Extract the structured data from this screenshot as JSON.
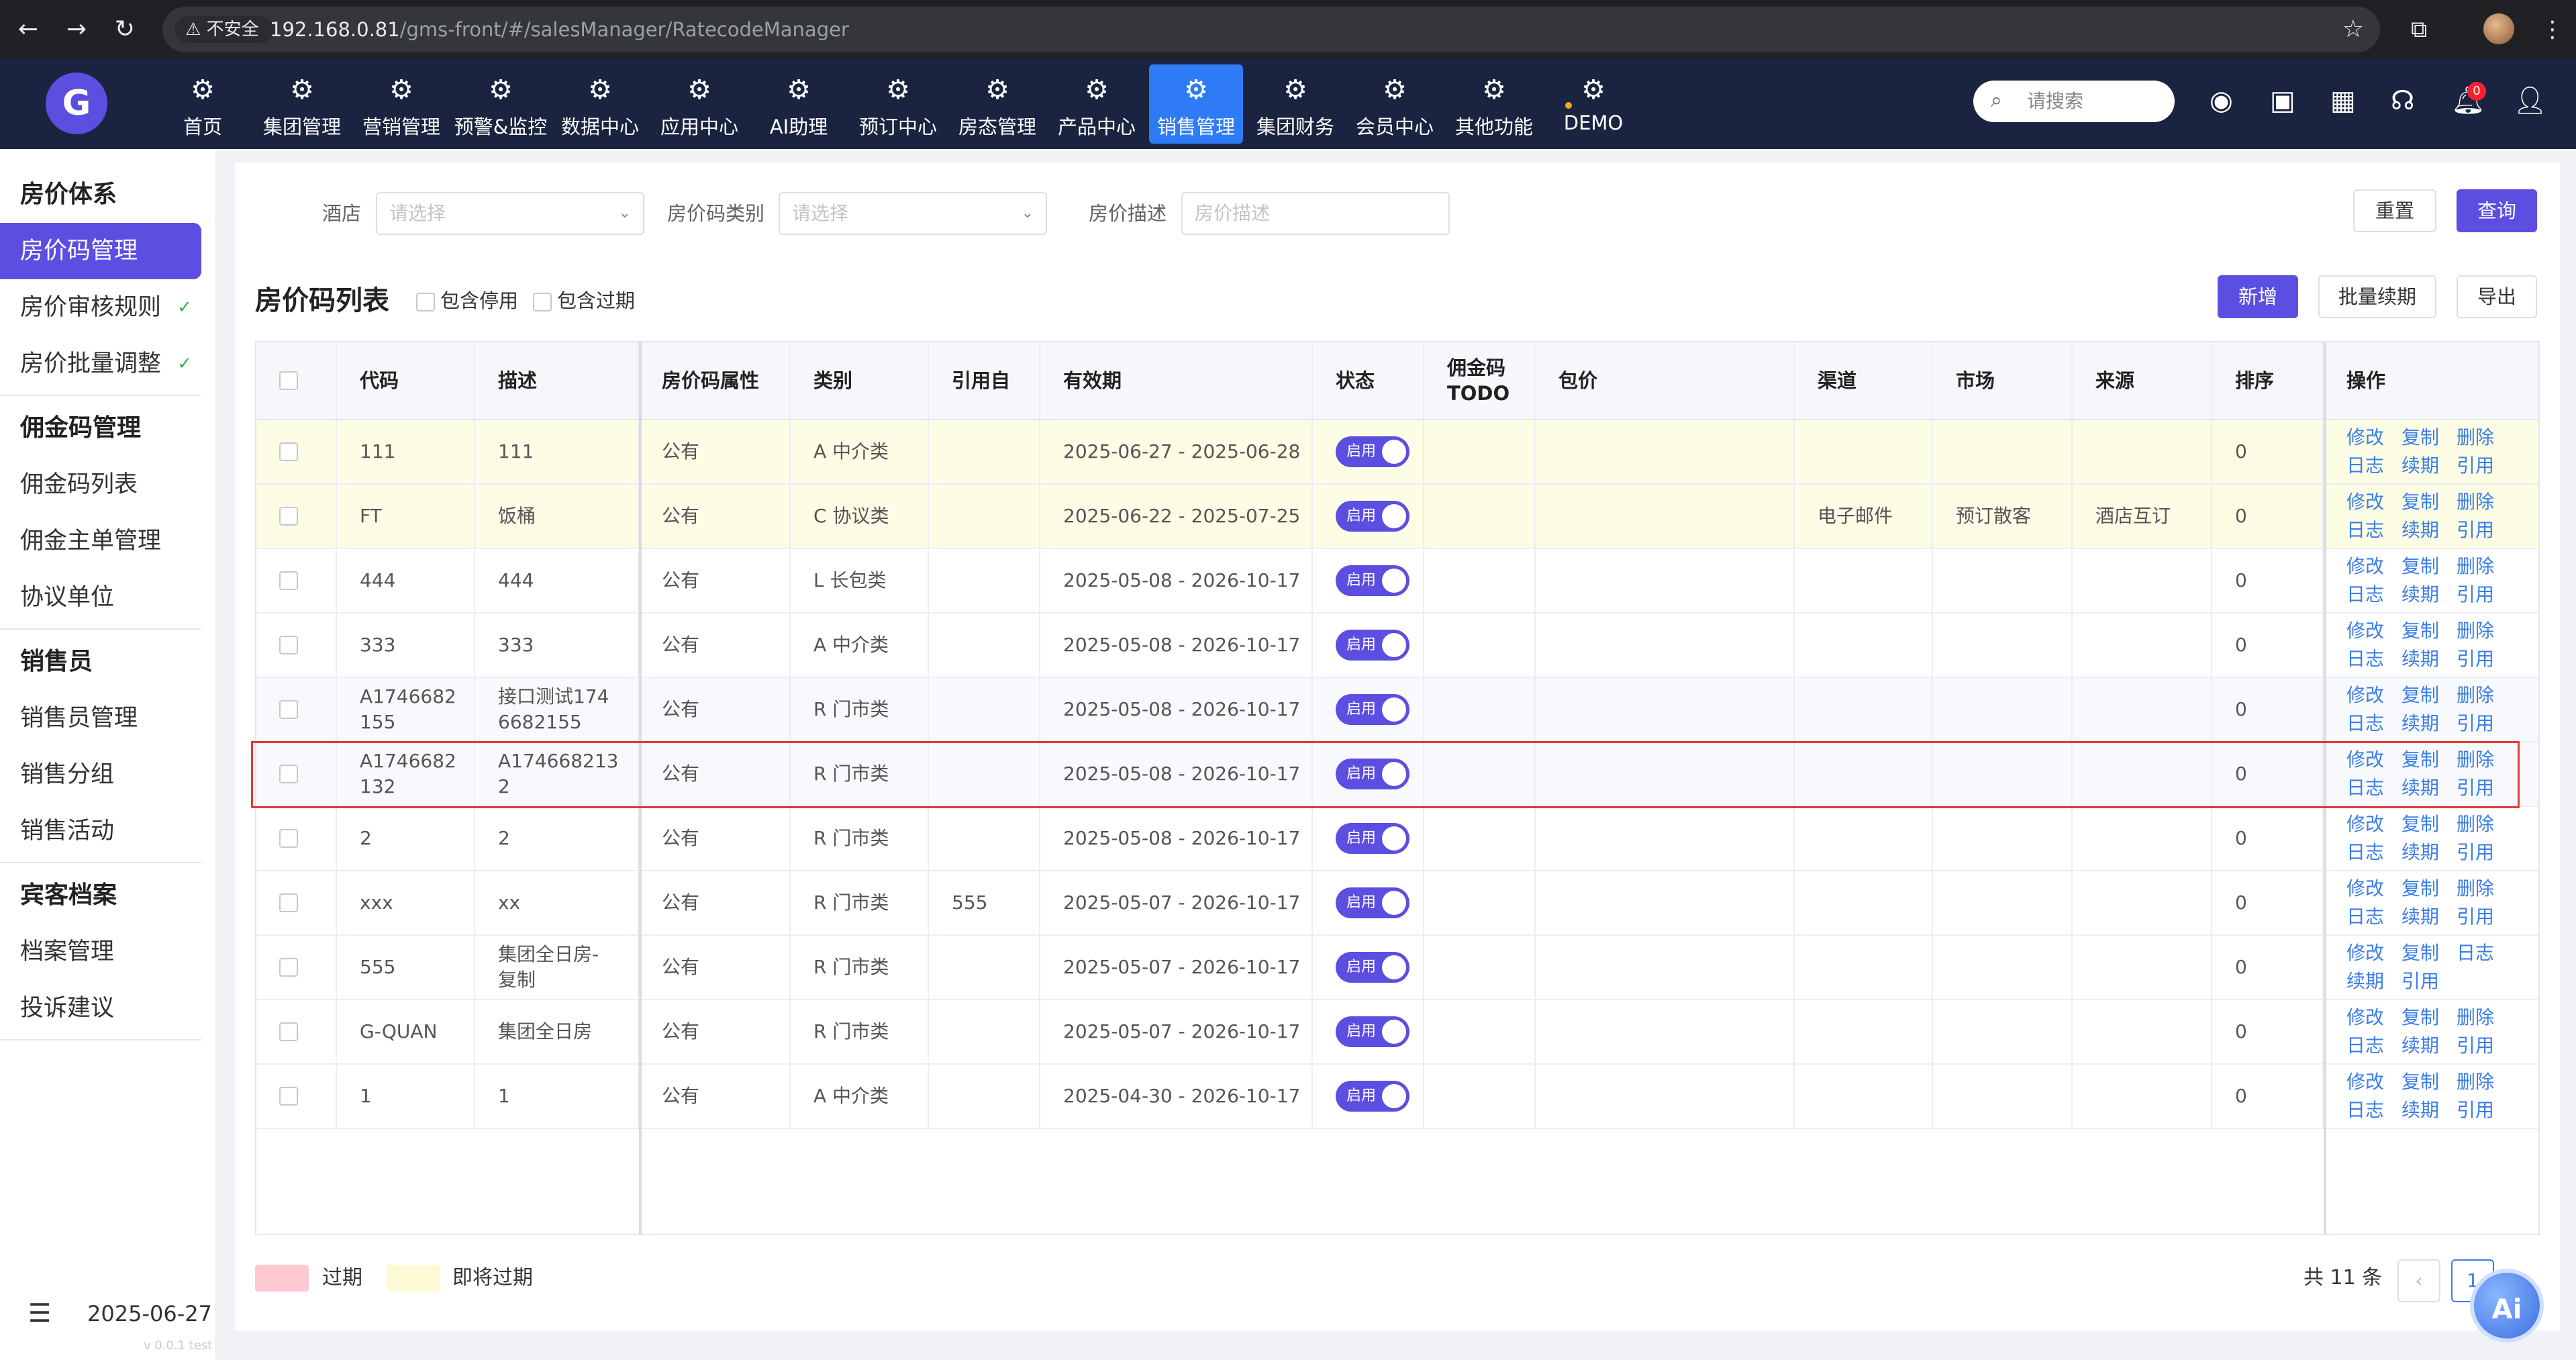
{
  "browser": {
    "back": "←",
    "forward": "→",
    "reload": "↻",
    "security_label": "⚠ 不安全",
    "url_host": "192.168.0.81",
    "url_path": "/gms-front/#/salesManager/RatecodeManager"
  },
  "topnav": {
    "items": [
      "首页",
      "集团管理",
      "营销管理",
      "预警&监控",
      "数据中心",
      "应用中心",
      "AI助理",
      "预订中心",
      "房态管理",
      "产品中心",
      "销售管理",
      "集团财务",
      "会员中心",
      "其他功能",
      "DEMO"
    ],
    "active": "销售管理",
    "search_placeholder": "请搜索",
    "notification_count": "0"
  },
  "sidebar": {
    "groups": [
      {
        "title": "房价体系",
        "items": [
          {
            "label": "房价码管理",
            "active": true
          },
          {
            "label": "房价审核规则",
            "check": "✓"
          },
          {
            "label": "房价批量调整",
            "check": "✓"
          }
        ]
      },
      {
        "title": "佣金码管理",
        "items": [
          {
            "label": "佣金码列表"
          },
          {
            "label": "佣金主单管理"
          },
          {
            "label": "协议单位"
          }
        ]
      },
      {
        "title": "销售员",
        "items": [
          {
            "label": "销售员管理"
          },
          {
            "label": "销售分组"
          },
          {
            "label": "销售活动"
          }
        ]
      },
      {
        "title": "宾客档案",
        "items": [
          {
            "label": "档案管理"
          },
          {
            "label": "投诉建议"
          }
        ]
      }
    ],
    "date": "2025-06-27",
    "version": "v 0.0.1 test"
  },
  "filters": {
    "hotel_label": "酒店",
    "hotel_placeholder": "请选择",
    "type_label": "房价码类别",
    "type_placeholder": "请选择",
    "desc_label": "房价描述",
    "desc_placeholder": "房价描述",
    "reset": "重置",
    "query": "查询"
  },
  "list": {
    "title": "房价码列表",
    "include_disabled": "包含停用",
    "include_expired": "包含过期",
    "add": "新增",
    "batch_renew": "批量续期",
    "export": "导出"
  },
  "table": {
    "headers": [
      "代码",
      "描述",
      "房价码属性",
      "类别",
      "引用自",
      "有效期",
      "状态",
      "佣金码\nTODO",
      "包价",
      "渠道",
      "市场",
      "来源",
      "排序",
      "操作"
    ],
    "switch_label": "启用",
    "rows": [
      {
        "code": "111",
        "desc": "111",
        "attr": "公有",
        "type": "A 中介类",
        "ref": "",
        "period": "2025-06-27 - 2025-06-28",
        "channel": "",
        "market": "",
        "source": "",
        "sort": "0",
        "ops": [
          [
            "修改",
            "复制",
            "删除"
          ],
          [
            "日志",
            "续期",
            "引用"
          ]
        ],
        "style": "warn"
      },
      {
        "code": "FT",
        "desc": "饭桶",
        "attr": "公有",
        "type": "C 协议类",
        "ref": "",
        "period": "2025-06-22 - 2025-07-25",
        "channel": "电子邮件",
        "market": "预订散客",
        "source": "酒店互订",
        "sort": "0",
        "ops": [
          [
            "修改",
            "复制",
            "删除"
          ],
          [
            "日志",
            "续期",
            "引用"
          ]
        ],
        "style": "warn"
      },
      {
        "code": "444",
        "desc": "444",
        "attr": "公有",
        "type": "L 长包类",
        "ref": "",
        "period": "2025-05-08 - 2026-10-17",
        "channel": "",
        "market": "",
        "source": "",
        "sort": "0",
        "ops": [
          [
            "修改",
            "复制",
            "删除"
          ],
          [
            "日志",
            "续期",
            "引用"
          ]
        ],
        "style": ""
      },
      {
        "code": "333",
        "desc": "333",
        "attr": "公有",
        "type": "A 中介类",
        "ref": "",
        "period": "2025-05-08 - 2026-10-17",
        "channel": "",
        "market": "",
        "source": "",
        "sort": "0",
        "ops": [
          [
            "修改",
            "复制",
            "删除"
          ],
          [
            "日志",
            "续期",
            "引用"
          ]
        ],
        "style": ""
      },
      {
        "code": "A1746682\n155",
        "desc": "接口测试174\n6682155",
        "attr": "公有",
        "type": "R 门市类",
        "ref": "",
        "period": "2025-05-08 - 2026-10-17",
        "channel": "",
        "market": "",
        "source": "",
        "sort": "0",
        "ops": [
          [
            "修改",
            "复制",
            "删除"
          ],
          [
            "日志",
            "续期",
            "引用"
          ]
        ],
        "style": "hl"
      },
      {
        "code": "A1746682\n132",
        "desc": "A174668213\n2",
        "attr": "公有",
        "type": "R 门市类",
        "ref": "",
        "period": "2025-05-08 - 2026-10-17",
        "channel": "",
        "market": "",
        "source": "",
        "sort": "0",
        "ops": [
          [
            "修改",
            "复制",
            "删除"
          ],
          [
            "日志",
            "续期",
            "引用"
          ]
        ],
        "style": "hl"
      },
      {
        "code": "2",
        "desc": "2",
        "attr": "公有",
        "type": "R 门市类",
        "ref": "",
        "period": "2025-05-08 - 2026-10-17",
        "channel": "",
        "market": "",
        "source": "",
        "sort": "0",
        "ops": [
          [
            "修改",
            "复制",
            "删除"
          ],
          [
            "日志",
            "续期",
            "引用"
          ]
        ],
        "style": ""
      },
      {
        "code": "xxx",
        "desc": "xx",
        "attr": "公有",
        "type": "R 门市类",
        "ref": "555",
        "period": "2025-05-07 - 2026-10-17",
        "channel": "",
        "market": "",
        "source": "",
        "sort": "0",
        "ops": [
          [
            "修改",
            "复制",
            "删除"
          ],
          [
            "日志",
            "续期",
            "引用"
          ]
        ],
        "style": ""
      },
      {
        "code": "555",
        "desc": "集团全日房-\n复制",
        "attr": "公有",
        "type": "R 门市类",
        "ref": "",
        "period": "2025-05-07 - 2026-10-17",
        "channel": "",
        "market": "",
        "source": "",
        "sort": "0",
        "ops": [
          [
            "修改",
            "复制",
            "日志"
          ],
          [
            "续期",
            "引用"
          ]
        ],
        "style": ""
      },
      {
        "code": "G-QUAN",
        "desc": "集团全日房",
        "attr": "公有",
        "type": "R 门市类",
        "ref": "",
        "period": "2025-05-07 - 2026-10-17",
        "channel": "",
        "market": "",
        "source": "",
        "sort": "0",
        "ops": [
          [
            "修改",
            "复制",
            "删除"
          ],
          [
            "日志",
            "续期",
            "引用"
          ]
        ],
        "style": ""
      },
      {
        "code": "1",
        "desc": "1",
        "attr": "公有",
        "type": "A 中介类",
        "ref": "",
        "period": "2025-04-30 - 2026-10-17",
        "channel": "",
        "market": "",
        "source": "",
        "sort": "0",
        "ops": [
          [
            "修改",
            "复制",
            "删除"
          ],
          [
            "日志",
            "续期",
            "引用"
          ]
        ],
        "style": ""
      }
    ]
  },
  "footer": {
    "legend_expired": "过期",
    "legend_expiring": "即将过期",
    "legend_expired_color": "#ffc9d2",
    "legend_expiring_color": "#fdfbd6",
    "total": "共 11 条",
    "page": "1",
    "ai": "Ai"
  }
}
